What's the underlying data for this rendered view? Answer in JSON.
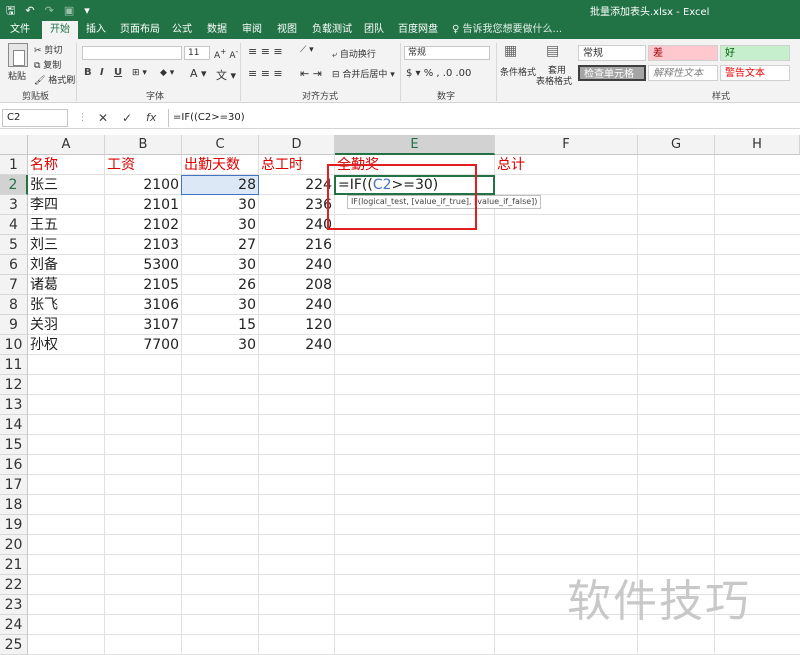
{
  "titlebar": {
    "title": "批量添加表头.xlsx - Excel",
    "qat": {
      "save_icon": "save-icon",
      "undo_icon": "undo-icon",
      "redo_icon": "redo-icon",
      "camera_icon": "camera-icon",
      "customize_icon": "customize-qat-icon"
    }
  },
  "tabs": [
    {
      "label": "文件"
    },
    {
      "label": "开始"
    },
    {
      "label": "插入"
    },
    {
      "label": "页面布局"
    },
    {
      "label": "公式"
    },
    {
      "label": "数据"
    },
    {
      "label": "审阅"
    },
    {
      "label": "视图"
    },
    {
      "label": "负载测试"
    },
    {
      "label": "团队"
    },
    {
      "label": "百度网盘"
    }
  ],
  "tellme": "告诉我您想要做什么...",
  "ribbon": {
    "clipboard": {
      "paste": "粘贴",
      "cut": "剪切",
      "copy": "复制",
      "format_painter": "格式刷",
      "group": "剪贴板"
    },
    "font": {
      "group": "字体",
      "size": "11",
      "bold": "B",
      "italic": "I",
      "underline": "U"
    },
    "alignment": {
      "wrap": "自动换行",
      "merge": "合并后居中",
      "group": "对齐方式"
    },
    "number": {
      "format": "常规",
      "group": "数字"
    },
    "styles": {
      "conditional": "条件格式",
      "table_format_1": "套用",
      "table_format_2": "表格格式",
      "normal": "常规",
      "bad": "差",
      "good": "好",
      "check_cell": "检查单元格",
      "explanatory": "解释性文本",
      "warning": "警告文本",
      "group": "样式"
    }
  },
  "formula_bar": {
    "name_box": "C2",
    "cancel": "✕",
    "enter": "✓",
    "fx": "fx",
    "formula": "=IF((C2>=30)"
  },
  "columns": [
    "A",
    "B",
    "C",
    "D",
    "E",
    "F",
    "G",
    "H"
  ],
  "rows": [
    "1",
    "2",
    "3",
    "4",
    "5",
    "6",
    "7",
    "8",
    "9",
    "10",
    "11",
    "12",
    "13",
    "14",
    "15",
    "16",
    "17",
    "18",
    "19",
    "20",
    "21",
    "22",
    "23",
    "24",
    "25"
  ],
  "headers": {
    "a": "名称",
    "b": "工资",
    "c": "出勤天数",
    "d": "总工时",
    "e": "全勤奖",
    "f": "总计"
  },
  "data": [
    {
      "name": "张三",
      "salary": "2100",
      "days": "28",
      "hours": "224"
    },
    {
      "name": "李四",
      "salary": "2101",
      "days": "30",
      "hours": "236"
    },
    {
      "name": "王五",
      "salary": "2102",
      "days": "30",
      "hours": "240"
    },
    {
      "name": "刘三",
      "salary": "2103",
      "days": "27",
      "hours": "216"
    },
    {
      "name": "刘备",
      "salary": "5300",
      "days": "30",
      "hours": "240"
    },
    {
      "name": "诸葛",
      "salary": "2105",
      "days": "26",
      "hours": "208"
    },
    {
      "name": "张飞",
      "salary": "3106",
      "days": "30",
      "hours": "240"
    },
    {
      "name": "关羽",
      "salary": "3107",
      "days": "15",
      "hours": "120"
    },
    {
      "name": "孙权",
      "salary": "7700",
      "days": "30",
      "hours": "240"
    }
  ],
  "editing": {
    "prefix": "=IF((",
    "ref": "C2",
    "suffix": ">=30)"
  },
  "tooltip": "IF(logical_test, [value_if_true], [value_if_false])",
  "watermark": "软件技巧",
  "colors": {
    "accent": "#217346",
    "header_red": "#dd0000",
    "ref_blue": "#4472c4",
    "annotation": "#e02020"
  }
}
